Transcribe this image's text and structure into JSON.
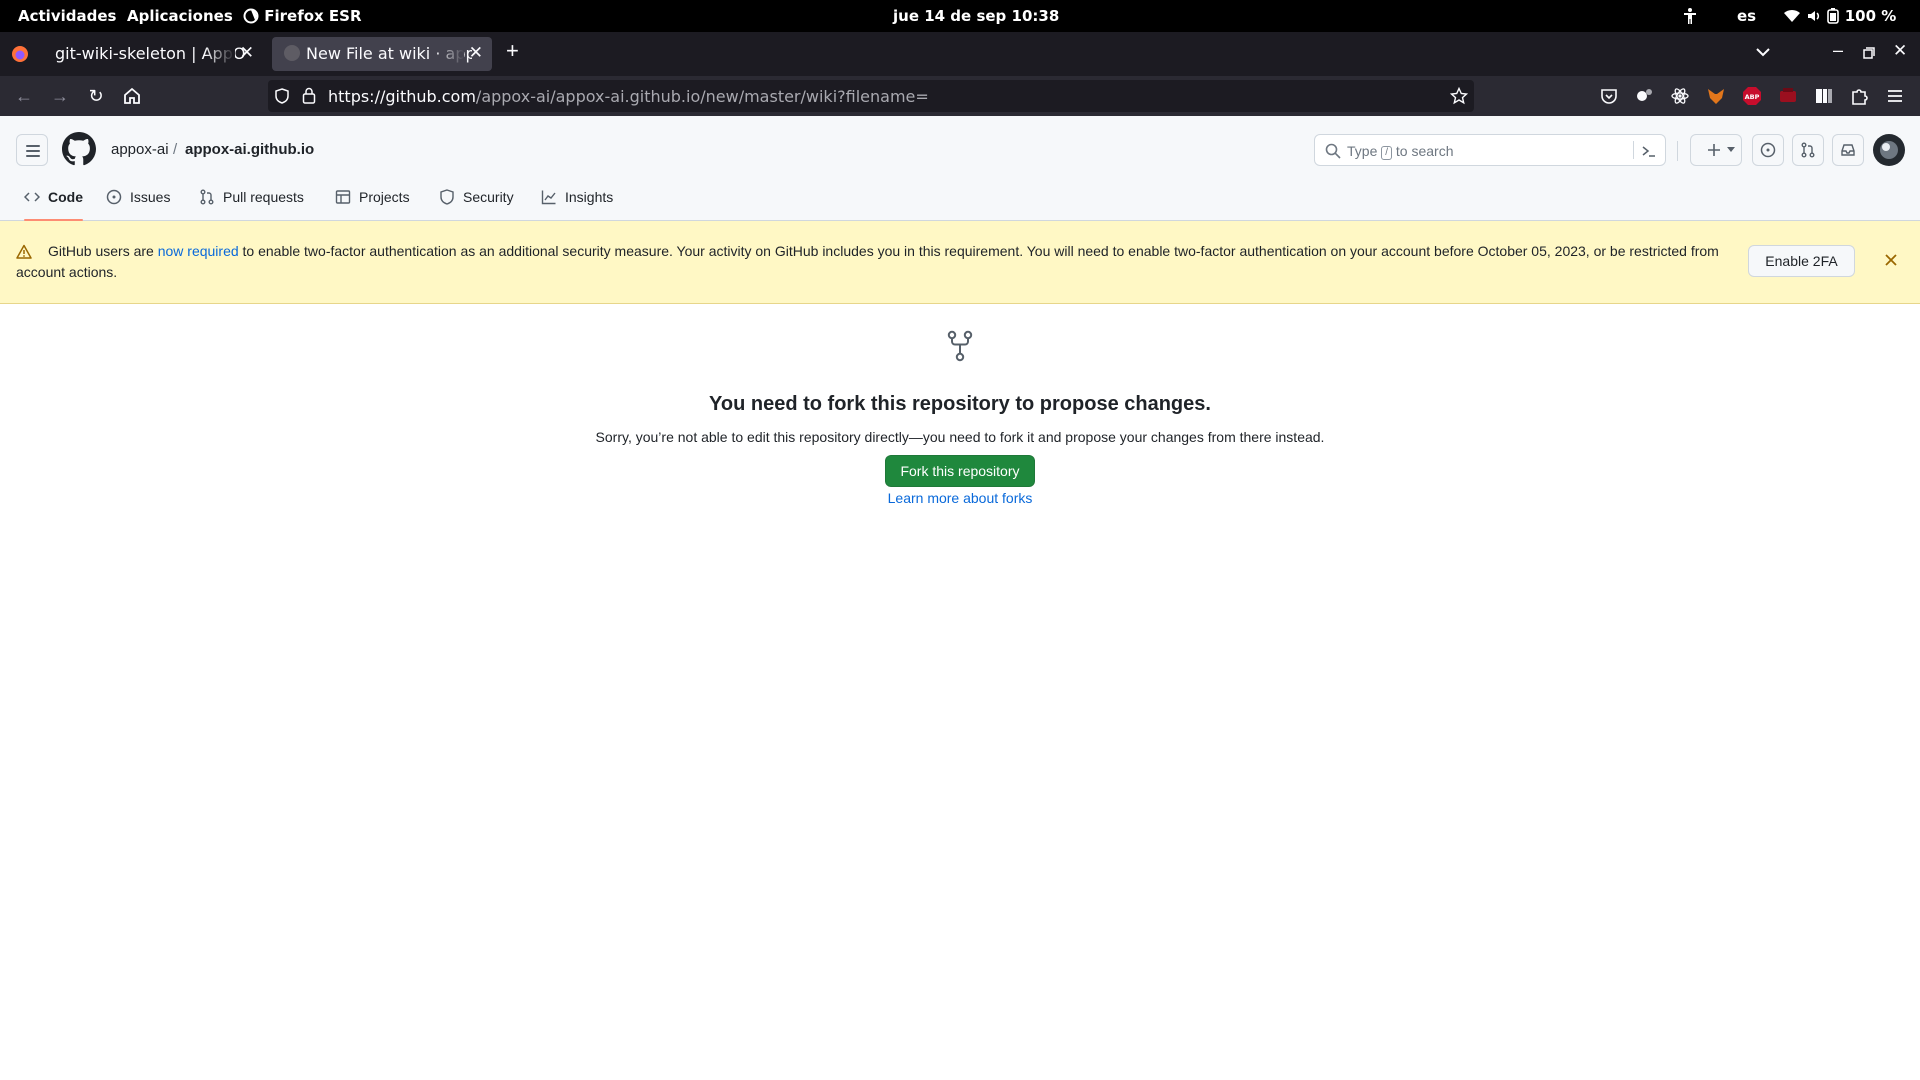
{
  "gnome": {
    "activities": "Actividades",
    "applications": "Aplicaciones",
    "app_name": "Firefox ESR",
    "clock": "jue 14 de sep  10:38",
    "language": "es",
    "battery": "100 %"
  },
  "tabs": [
    {
      "title": "git-wiki-skeleton | AppOX",
      "active": false
    },
    {
      "title": "New File at wiki · appox",
      "active": true
    }
  ],
  "navbar": {
    "url_host": "https://github.com",
    "url_path": "/appox-ai/appox-ai.github.io/new/master/wiki?filename="
  },
  "github": {
    "owner": "appox-ai",
    "separator": "/",
    "repo": "appox-ai.github.io",
    "search_type": "Type",
    "search_key": "/",
    "search_rest": "to search",
    "repo_tabs": [
      {
        "label": "Code",
        "icon": "code-icon",
        "active": true
      },
      {
        "label": "Issues",
        "icon": "issue-icon",
        "active": false
      },
      {
        "label": "Pull requests",
        "icon": "pull-request-icon",
        "active": false
      },
      {
        "label": "Projects",
        "icon": "table-icon",
        "active": false
      },
      {
        "label": "Security",
        "icon": "shield-icon",
        "active": false
      },
      {
        "label": "Insights",
        "icon": "graph-icon",
        "active": false
      }
    ]
  },
  "banner": {
    "text_before": "GitHub users are ",
    "link": "now required",
    "text_after": " to enable two-factor authentication as an additional security measure. Your activity on GitHub includes you in this requirement. You will need to enable two-factor authentication on your account before October 05, 2023, or be restricted from account actions.",
    "button": "Enable 2FA"
  },
  "main": {
    "heading": "You need to fork this repository to propose changes.",
    "description": "Sorry, you’re not able to edit this repository directly—you need to fork it and propose your changes from there instead.",
    "fork_button": "Fork this repository",
    "learn_link": "Learn more about forks"
  },
  "colors": {
    "primary_button": "#1f883d",
    "link": "#0969da",
    "banner_bg": "#fff8c5",
    "active_tab_underline": "#fd8c73"
  }
}
